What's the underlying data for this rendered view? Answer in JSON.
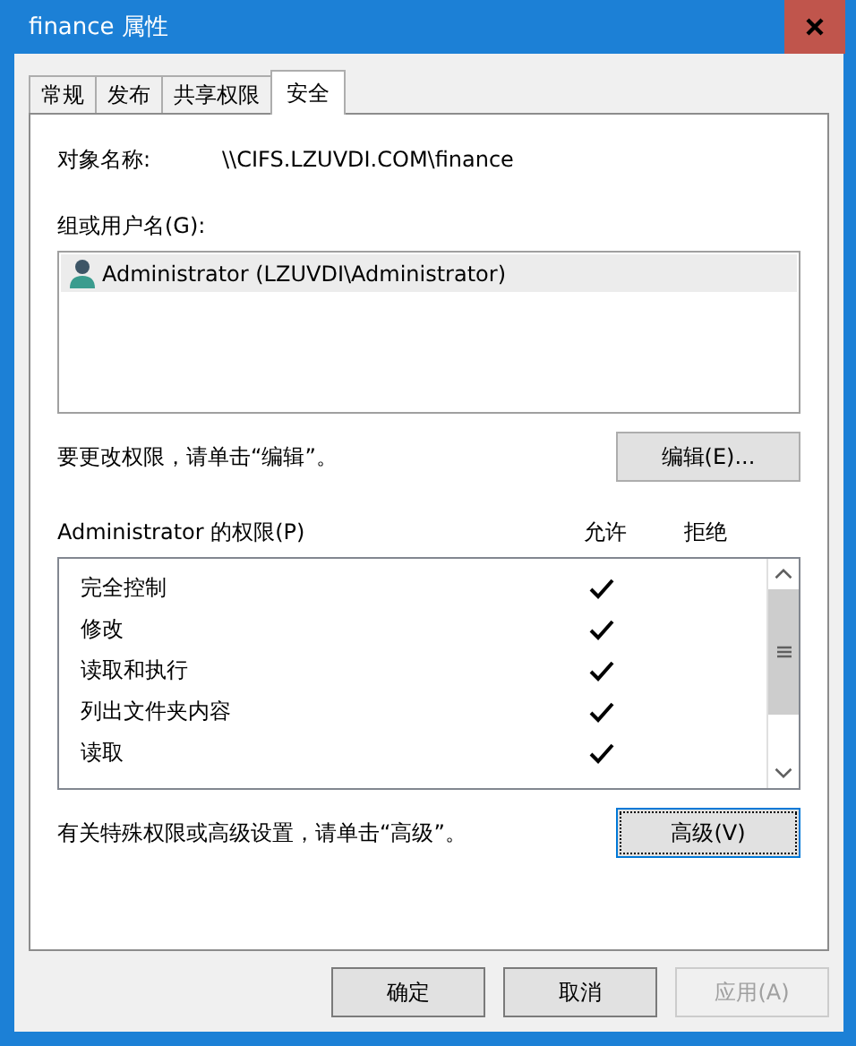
{
  "window": {
    "title": "finance 属性"
  },
  "tabs": [
    {
      "label": "常规",
      "selected": false
    },
    {
      "label": "发布",
      "selected": false
    },
    {
      "label": "共享权限",
      "selected": false
    },
    {
      "label": "安全",
      "selected": true
    }
  ],
  "object_name": {
    "label": "对象名称:",
    "value": "\\\\CIFS.LZUVDI.COM\\finance"
  },
  "groups": {
    "label": "组或用户名(G):",
    "items": [
      {
        "name": "Administrator (LZUVDI\\Administrator)",
        "selected": true
      }
    ]
  },
  "edit_hint": "要更改权限，请单击“编辑”。",
  "edit_button": "编辑(E)...",
  "permissions": {
    "label": "Administrator 的权限(P)",
    "allow_header": "允许",
    "deny_header": "拒绝",
    "rows": [
      {
        "name": "完全控制",
        "allow": true,
        "deny": false
      },
      {
        "name": "修改",
        "allow": true,
        "deny": false
      },
      {
        "name": "读取和执行",
        "allow": true,
        "deny": false
      },
      {
        "name": "列出文件夹内容",
        "allow": true,
        "deny": false
      },
      {
        "name": "读取",
        "allow": true,
        "deny": false
      }
    ]
  },
  "advanced_hint": "有关特殊权限或高级设置，请单击“高级”。",
  "advanced_button": {
    "label": "高级(V)",
    "focused": true
  },
  "buttons": [
    {
      "label": "确定",
      "disabled": false
    },
    {
      "label": "取消",
      "disabled": false
    },
    {
      "label": "应用(A)",
      "disabled": true
    }
  ]
}
